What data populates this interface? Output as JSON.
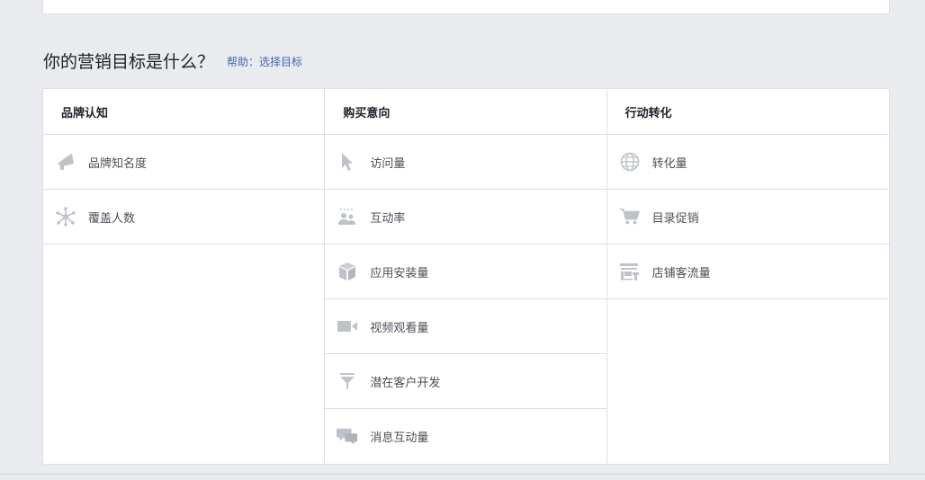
{
  "heading": {
    "title": "你的营销目标是什么？",
    "help": "帮助：选择目标"
  },
  "columns": [
    {
      "title": "品牌认知",
      "items": [
        {
          "label": "品牌知名度",
          "icon": "megaphone-icon"
        },
        {
          "label": "覆盖人数",
          "icon": "reach-icon"
        }
      ]
    },
    {
      "title": "购买意向",
      "items": [
        {
          "label": "访问量",
          "icon": "cursor-icon"
        },
        {
          "label": "互动率",
          "icon": "people-icon"
        },
        {
          "label": "应用安装量",
          "icon": "box-icon"
        },
        {
          "label": "视频观看量",
          "icon": "video-camera-icon"
        },
        {
          "label": "潜在客户开发",
          "icon": "funnel-icon"
        },
        {
          "label": "消息互动量",
          "icon": "chat-bubbles-icon"
        }
      ]
    },
    {
      "title": "行动转化",
      "items": [
        {
          "label": "转化量",
          "icon": "globe-icon"
        },
        {
          "label": "目录促销",
          "icon": "shopping-cart-icon"
        },
        {
          "label": "店铺客流量",
          "icon": "storefront-icon"
        }
      ]
    }
  ],
  "colors": {
    "icon": "#bec3c9",
    "link": "#4267b2",
    "text": "#4b4f56"
  }
}
